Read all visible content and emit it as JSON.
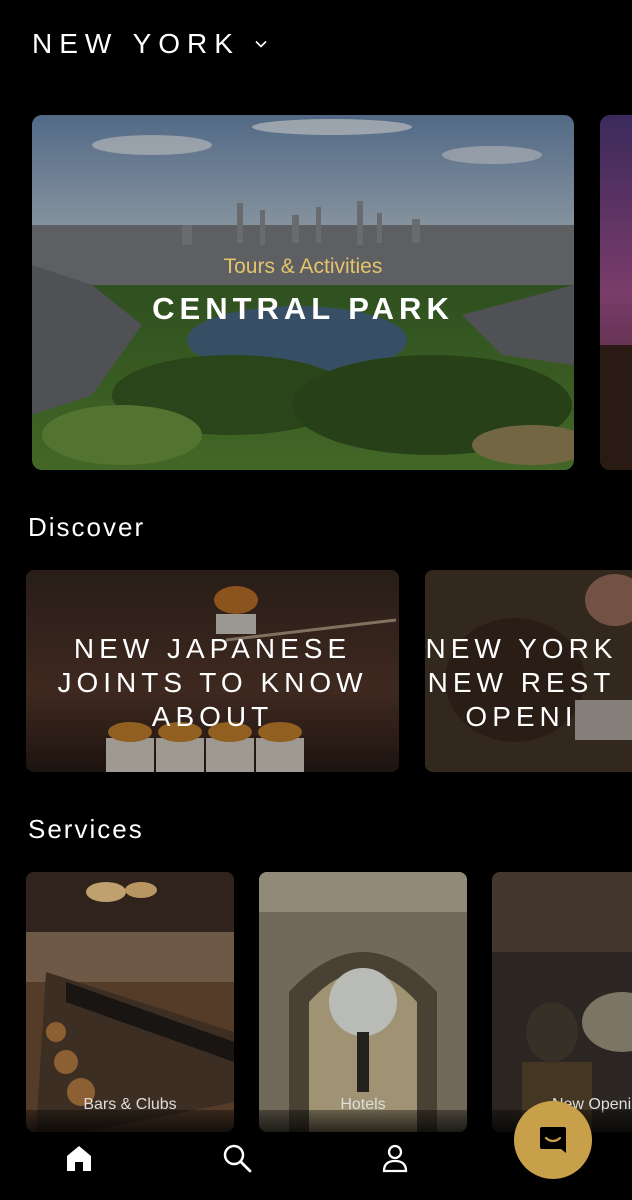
{
  "header": {
    "city": "NEW YORK"
  },
  "hero": {
    "category": "Tours & Activities",
    "title": "CENTRAL PARK"
  },
  "discover": {
    "title": "Discover",
    "cards": [
      {
        "lines": [
          "NEW JAPANESE",
          "JOINTS TO KNOW",
          "ABOUT"
        ]
      },
      {
        "lines": [
          "NEW YORK",
          "NEW REST",
          "OPENI"
        ]
      }
    ]
  },
  "services": {
    "title": "Services",
    "cards": [
      {
        "label": "Bars & Clubs"
      },
      {
        "label": "Hotels"
      },
      {
        "label": "New Openin"
      }
    ]
  },
  "tabs": [
    {
      "icon": "home-icon"
    },
    {
      "icon": "search-icon"
    },
    {
      "icon": "profile-icon"
    },
    {
      "icon": "chat-icon"
    }
  ],
  "colors": {
    "accent": "#c8a04a",
    "category": "#e6c36a",
    "background": "#000000"
  }
}
